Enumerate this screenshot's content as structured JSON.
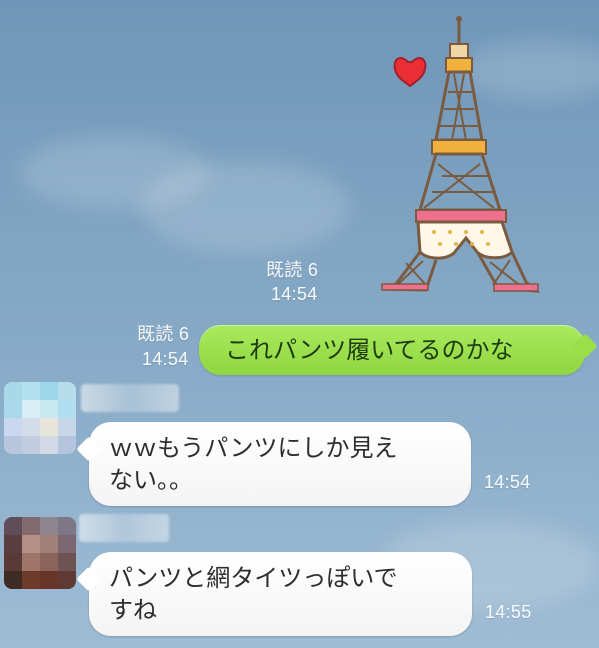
{
  "sticker": {
    "description_icon": "eiffel-tower-underwear-sticker"
  },
  "sticker_meta": {
    "read": "既読 6",
    "time": "14:54"
  },
  "sent_message": {
    "read": "既読 6",
    "time": "14:54",
    "text": "これパンツ履いてるのかな"
  },
  "messages": [
    {
      "text_line1": "ｗｗもうパンツにしか見え",
      "text_line2": "ない。。",
      "time": "14:54"
    },
    {
      "text_line1": "パンツと網タイツっぽいで",
      "text_line2": "すね",
      "time": "14:55"
    }
  ],
  "colors": {
    "sent_bubble": "#9bde4d",
    "received_bubble": "#ffffff",
    "background": "#7ea2c0"
  }
}
